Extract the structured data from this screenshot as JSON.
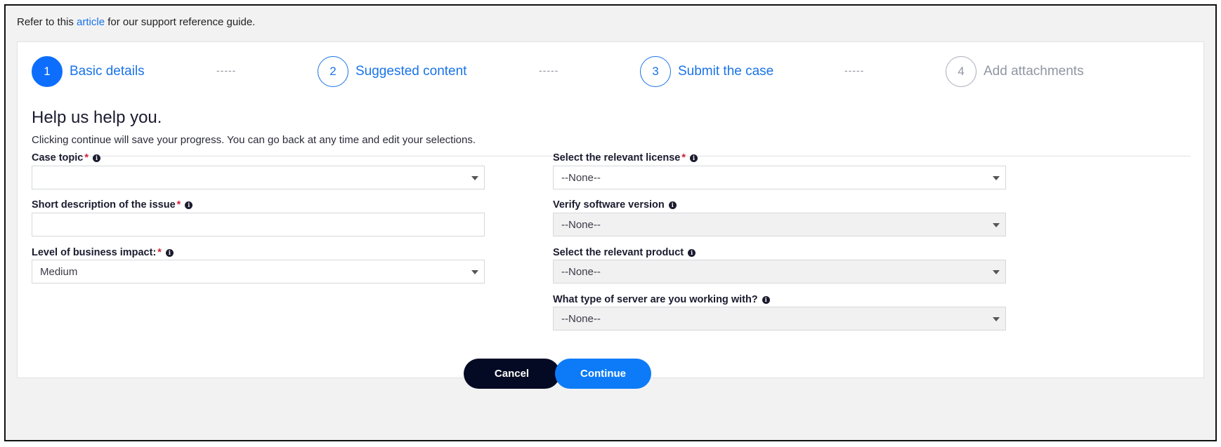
{
  "intro": {
    "prefix": "Refer to this ",
    "link": "article",
    "suffix": " for our support reference guide."
  },
  "stepper": {
    "steps": [
      {
        "number": "1",
        "label": "Basic details",
        "state": "active"
      },
      {
        "number": "2",
        "label": "Suggested content",
        "state": "upcoming"
      },
      {
        "number": "3",
        "label": "Submit the case",
        "state": "upcoming"
      },
      {
        "number": "4",
        "label": "Add attachments",
        "state": "disabled"
      }
    ],
    "separator": "-----"
  },
  "form": {
    "heading": "Help us help you.",
    "subtext": "Clicking continue will save your progress. You can go back at any time and edit your selections.",
    "required_mark": "*",
    "info_glyph": "i",
    "case_topic": {
      "label": "Case topic",
      "value": ""
    },
    "short_description": {
      "label": "Short description of the issue",
      "value": ""
    },
    "business_impact": {
      "label": "Level of business impact:",
      "value": "Medium"
    },
    "license": {
      "label": "Select the relevant license",
      "value": "--None--"
    },
    "software_version": {
      "label": "Verify software version",
      "value": "--None--"
    },
    "product": {
      "label": "Select the relevant product",
      "value": "--None--"
    },
    "server_type": {
      "label": "What type of server are you working with?",
      "value": "--None--"
    }
  },
  "buttons": {
    "cancel": "Cancel",
    "continue": "Continue"
  },
  "colors": {
    "accent": "#0d7bf7",
    "dark_button": "#050a24",
    "required": "#d1233b"
  }
}
